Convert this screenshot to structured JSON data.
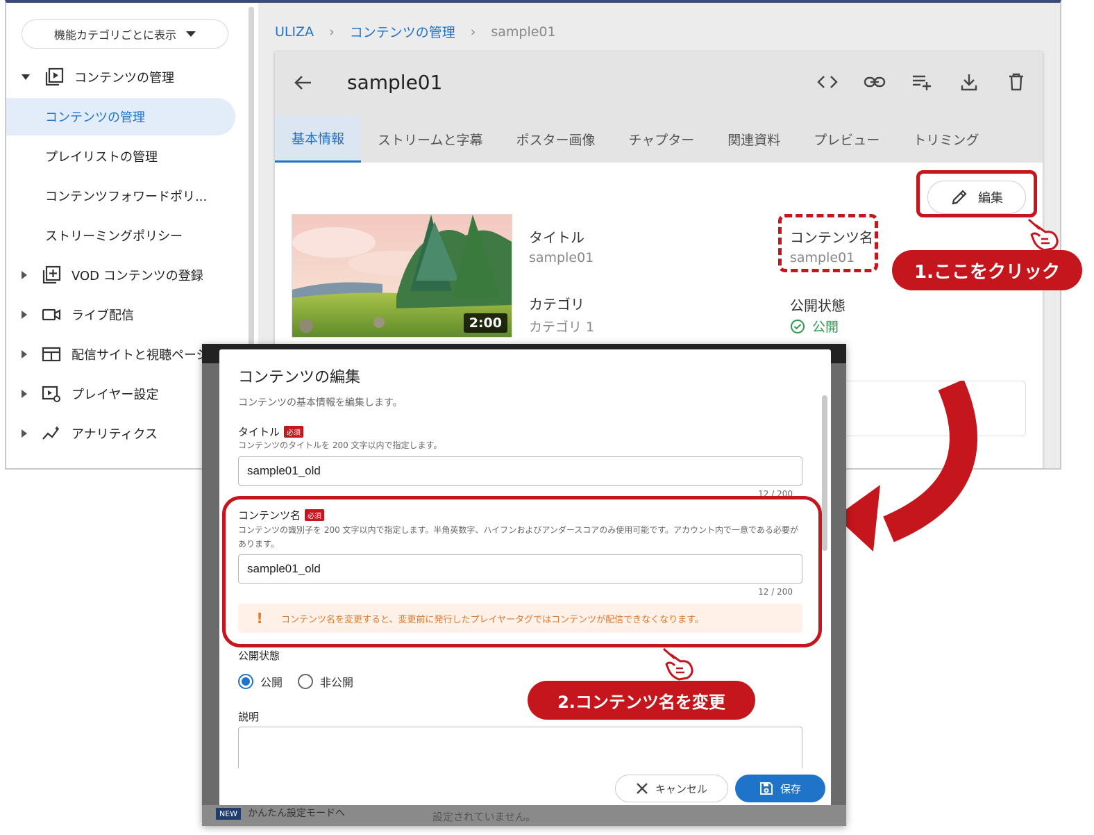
{
  "sidebar": {
    "category_select": "機能カテゴリごとに表示",
    "section_content": "コンテンツの管理",
    "sub_items": [
      "コンテンツの管理",
      "プレイリストの管理",
      "コンテンツフォワードポリ...",
      "ストリーミングポリシー"
    ],
    "groups": [
      "VOD コンテンツの登録",
      "ライブ配信",
      "配信サイトと視聴ページ",
      "プレイヤー設定",
      "アナリティクス"
    ]
  },
  "breadcrumb": [
    "ULIZA",
    "コンテンツの管理",
    "sample01"
  ],
  "card": {
    "title": "sample01",
    "tabs": [
      "基本情報",
      "ストリームと字幕",
      "ポスター画像",
      "チャプター",
      "関連資料",
      "プレビュー",
      "トリミング"
    ],
    "edit_label": "編集",
    "thumb_duration": "2:00",
    "fields": {
      "title_label": "タイトル",
      "title_value": "sample01",
      "name_label": "コンテンツ名",
      "name_value": "sample01",
      "category_label": "カテゴリ",
      "category_value": "カテゴリ 1",
      "status_label": "公開状態",
      "status_value": "公開"
    }
  },
  "annotations": {
    "step1": "1.ここをクリック",
    "step2": "2.コンテンツ名を変更"
  },
  "dialog": {
    "title": "コンテンツの編集",
    "subtitle": "コンテンツの基本情報を編集します。",
    "title_field_label": "タイトル",
    "required_badge": "必須",
    "title_help": "コンテンツのタイトルを 200 文字以内で指定します。",
    "title_value": "sample01_old",
    "title_count": "12 / 200",
    "name_field_label": "コンテンツ名",
    "name_help": "コンテンツの識別子を 200 文字以内で指定します。半角英数字、ハイフンおよびアンダースコアのみ使用可能です。アカウント内で一意である必要があります。",
    "name_value": "sample01_old",
    "name_count": "12 / 200",
    "warning": "コンテンツ名を変更すると、変更前に発行したプレイヤータグではコンテンツが配信できなくなります。",
    "status_label": "公開状態",
    "status_options": [
      "公開",
      "非公開"
    ],
    "status_selected": "公開",
    "description_label": "説明",
    "cancel_label": "キャンセル",
    "save_label": "保存"
  },
  "overlay_footer": {
    "badge": "NEW",
    "text": "かんたん設定モードへ",
    "note": "設定されていません。"
  },
  "colors": {
    "accent": "#1f74c9",
    "annotation_red": "#c4161c",
    "success": "#2e9b4e",
    "warning": "#e0782c"
  }
}
